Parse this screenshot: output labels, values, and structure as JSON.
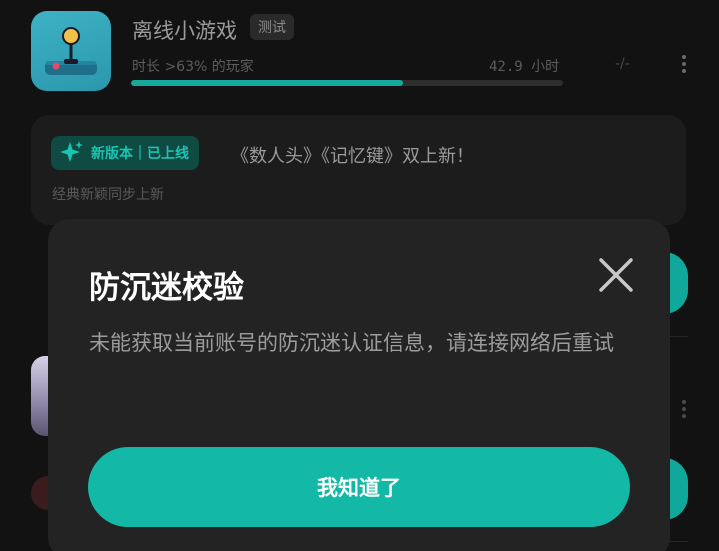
{
  "game": {
    "title": "离线小游戏",
    "badge": "测试",
    "playtime_rank": "时长 >63% 的玩家",
    "playtime_hours": "42.9 小时",
    "rating": "-/-",
    "progress_percent": 63,
    "icon": "joystick-icon"
  },
  "news": {
    "tag_label": "新版本｜已上线",
    "tag_icon": "sparkle-icon",
    "headline": "《数人头》《记忆键》双上新！",
    "subtitle": "经典新颖同步上新"
  },
  "dialog": {
    "title": "防沉迷校验",
    "message": "未能获取当前账号的防沉迷认证信息，请连接网络后重试",
    "confirm_label": "我知道了",
    "close_icon": "close-icon"
  },
  "colors": {
    "accent": "#14b8a6",
    "background": "#121212",
    "dialog_bg": "#232323"
  }
}
